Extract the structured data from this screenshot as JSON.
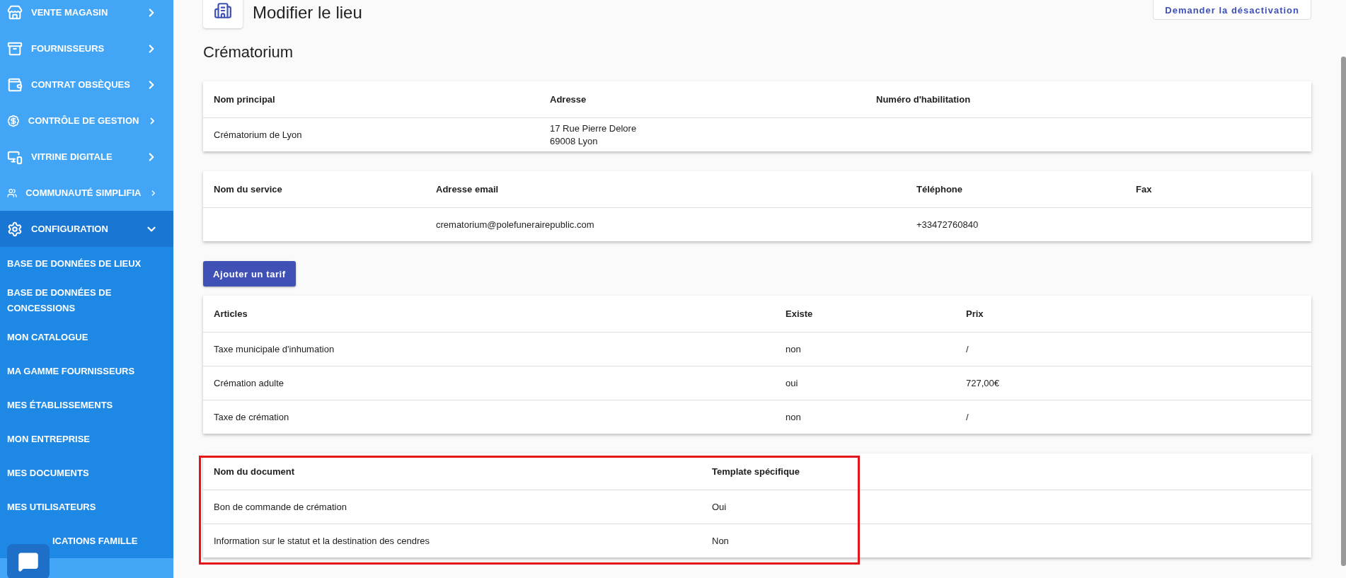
{
  "sidebar": {
    "items": [
      {
        "label": "VENTE MAGASIN",
        "expanded": false
      },
      {
        "label": "FOURNISSEURS",
        "expanded": false
      },
      {
        "label": "CONTRAT OBSÈQUES",
        "expanded": false
      },
      {
        "label": "CONTRÔLE DE GESTION",
        "expanded": false
      },
      {
        "label": "VITRINE DIGITALE",
        "expanded": false
      },
      {
        "label": "COMMUNAUTÉ SIMPLIFIA",
        "expanded": false
      },
      {
        "label": "CONFIGURATION",
        "expanded": true,
        "children": [
          {
            "label": "BASE DE DONNÉES DE LIEUX"
          },
          {
            "label": "BASE DE DONNÉES DE CONCESSIONS"
          },
          {
            "label": "MON CATALOGUE"
          },
          {
            "label": "MA GAMME FOURNISSEURS"
          },
          {
            "label": "MES ÉTABLISSEMENTS"
          },
          {
            "label": "MON ENTREPRISE"
          },
          {
            "label": "MES DOCUMENTS"
          },
          {
            "label": "MES UTILISATEURS"
          },
          {
            "label": "ICATIONS FAMILLE"
          }
        ]
      }
    ]
  },
  "header": {
    "title": "Modifier le lieu",
    "action": "Demander la désactivation"
  },
  "section_title": "Crématorium",
  "tables": [
    {
      "columns": [
        "Nom principal",
        "Adresse",
        "Numéro d'habilitation"
      ],
      "rows": [
        [
          "Crématorium de Lyon",
          "17 Rue Pierre Delore\n69008 Lyon",
          null
        ]
      ]
    },
    {
      "columns": [
        "Nom du service",
        "Adresse email",
        "Téléphone",
        "Fax"
      ],
      "rows": [
        [
          null,
          "crematorium@polefunerairepublic.com",
          "+33472760840",
          null
        ]
      ]
    },
    {
      "kind": "button",
      "label": "Ajouter un tarif"
    },
    {
      "columns": [
        "Articles",
        "Existe",
        "Prix"
      ],
      "rows": [
        [
          "Taxe municipale d'inhumation",
          "non",
          "/"
        ],
        [
          "Crémation adulte",
          "oui",
          "727,00€"
        ],
        [
          "Taxe de crémation",
          "non",
          "/"
        ]
      ]
    },
    {
      "columns": [
        "Nom du document",
        "Template spécifique"
      ],
      "highlighted": true,
      "rows": [
        [
          "Bon de commande de crémation",
          "Oui"
        ],
        [
          "Information sur le statut et la destination des cendres",
          "Non"
        ]
      ]
    }
  ]
}
